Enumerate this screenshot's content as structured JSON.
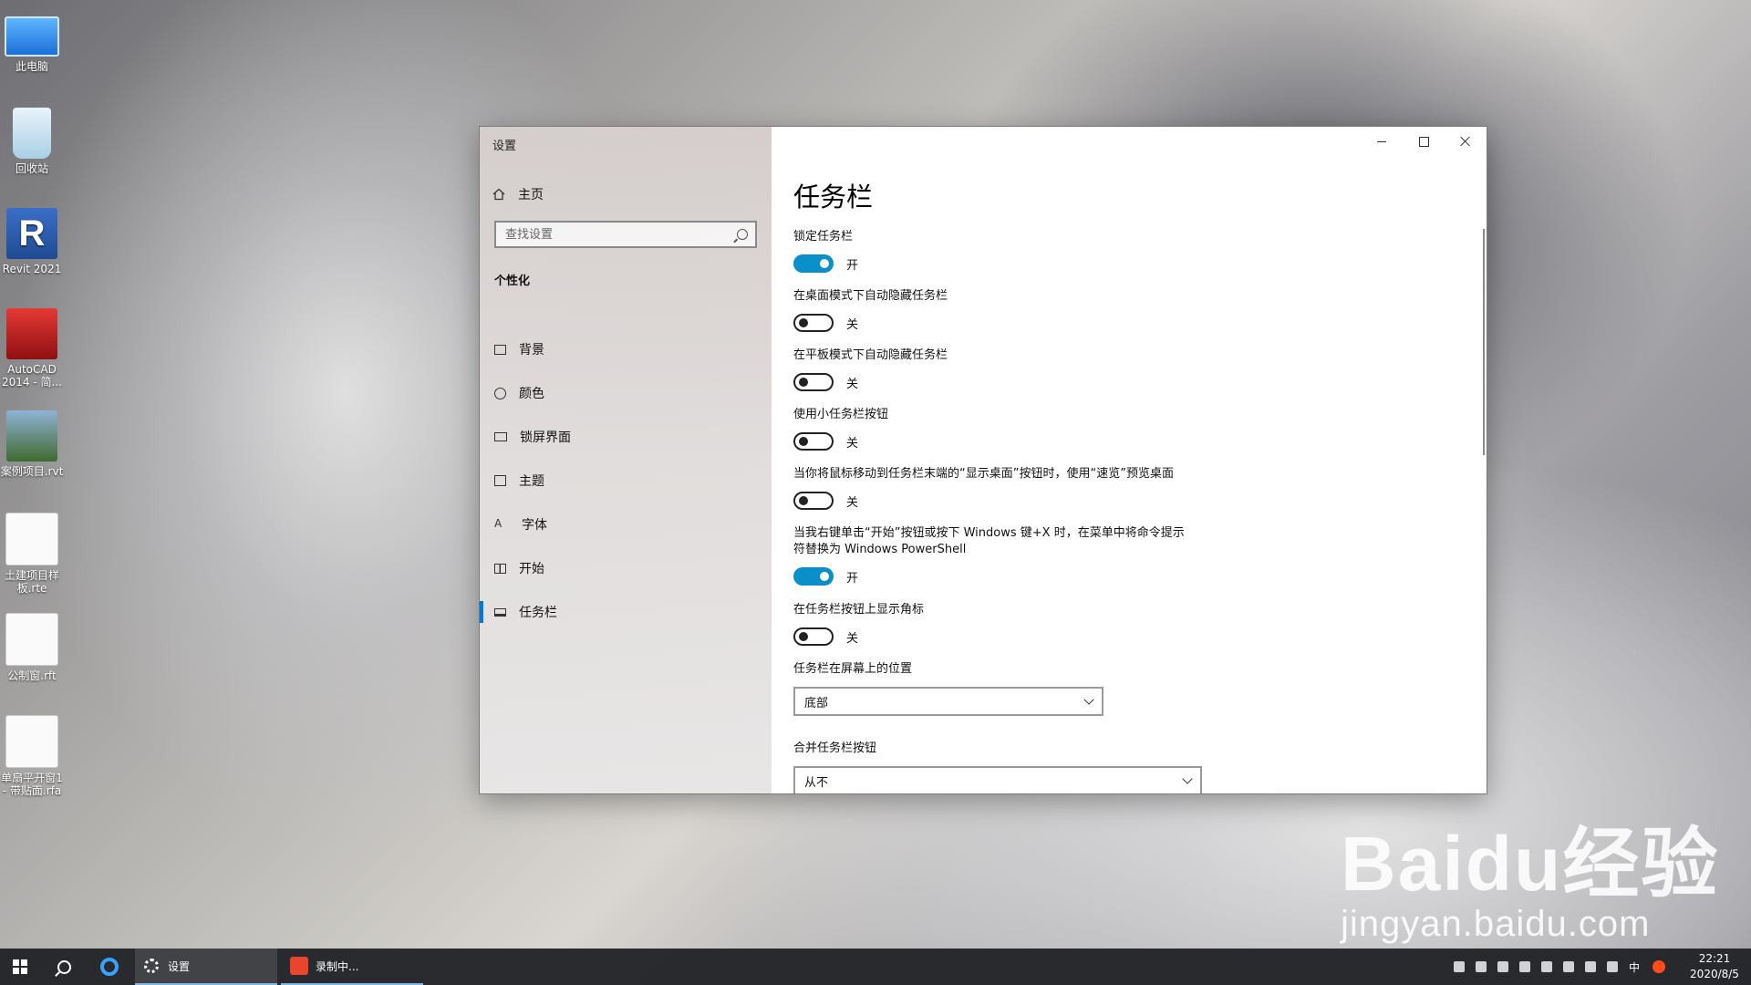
{
  "desktop": {
    "icons": [
      {
        "label": "此电脑"
      },
      {
        "label": "回收站"
      },
      {
        "label": "Revit 2021",
        "glyph": "R"
      },
      {
        "label": "AutoCAD 2014 - 简..."
      },
      {
        "label": "案例项目.rvt"
      },
      {
        "label": "土建项目样板.rte"
      },
      {
        "label": "公制窗.rft"
      },
      {
        "label": "单扇平开窗1 - 带贴面.rfa"
      }
    ]
  },
  "window": {
    "title": "设置",
    "controls": {
      "minimize_icon": "minimize-icon",
      "maximize_icon": "maximize-icon",
      "close_icon": "close-icon"
    }
  },
  "sidebar": {
    "home_label": "主页",
    "search_placeholder": "查找设置",
    "section": "个性化",
    "items": [
      {
        "label": "背景",
        "icon": "image-icon"
      },
      {
        "label": "颜色",
        "icon": "palette-icon"
      },
      {
        "label": "锁屏界面",
        "icon": "lock-screen-icon"
      },
      {
        "label": "主题",
        "icon": "theme-icon"
      },
      {
        "label": "字体",
        "icon": "font-icon",
        "glyph": "A"
      },
      {
        "label": "开始",
        "icon": "start-icon"
      },
      {
        "label": "任务栏",
        "icon": "taskbar-icon",
        "active": true
      }
    ]
  },
  "main": {
    "title": "任务栏",
    "settings": [
      {
        "label": "锁定任务栏",
        "on": true,
        "state": "开"
      },
      {
        "label": "在桌面模式下自动隐藏任务栏",
        "on": false,
        "state": "关"
      },
      {
        "label": "在平板模式下自动隐藏任务栏",
        "on": false,
        "state": "关"
      },
      {
        "label": "使用小任务栏按钮",
        "on": false,
        "state": "关"
      },
      {
        "label": "当你将鼠标移动到任务栏末端的“显示桌面”按钮时，使用“速览”预览桌面",
        "on": false,
        "state": "关"
      },
      {
        "label": "当我右键单击“开始”按钮或按下 Windows 键+X 时，在菜单中将命令提示符替换为 Windows PowerShell",
        "on": true,
        "state": "开"
      },
      {
        "label": "在任务栏按钮上显示角标",
        "on": false,
        "state": "关"
      }
    ],
    "position": {
      "label": "任务栏在屏幕上的位置",
      "value": "底部"
    },
    "combine": {
      "label": "合并任务栏按钮",
      "value": "从不"
    }
  },
  "taskbar": {
    "settings_label": "设置",
    "recording_label": "录制中...",
    "lang": "中",
    "time": "22:21",
    "date": "2020/8/5"
  },
  "watermark": {
    "big": "Baidu经验",
    "small": "jingyan.baidu.com"
  },
  "colors": {
    "accent": "#0078d7",
    "toggle_on": "#0a8fc8"
  }
}
